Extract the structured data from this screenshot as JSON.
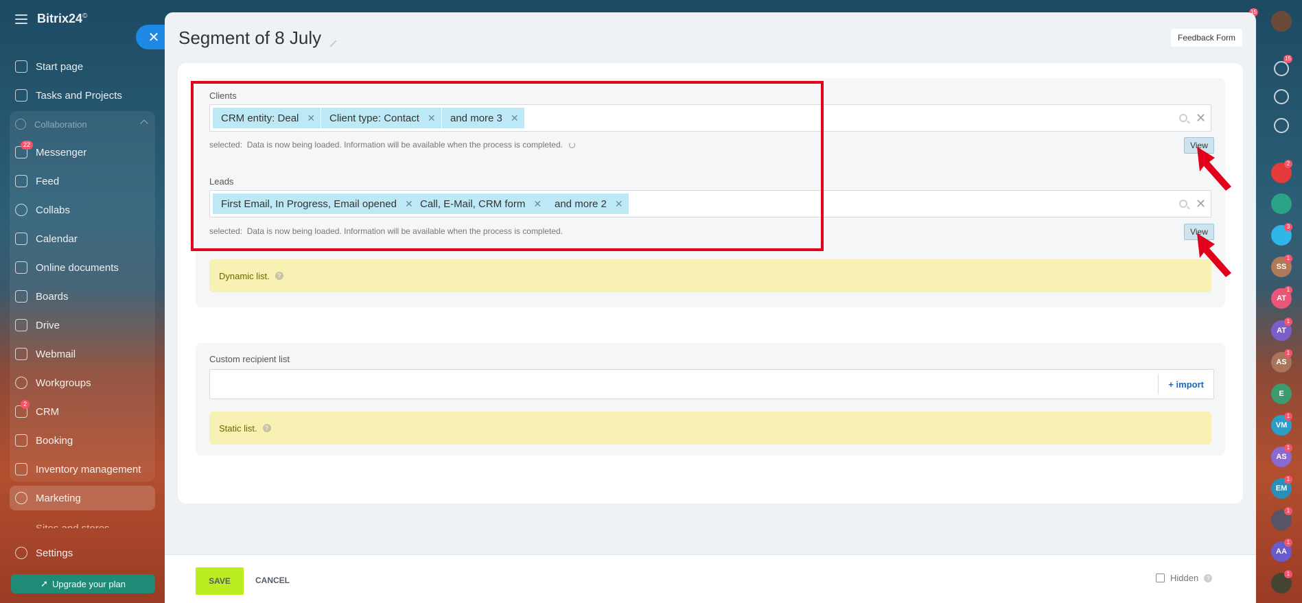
{
  "sidebar": {
    "logo": "Bitrix24",
    "logo_mark": "©",
    "items": [
      {
        "label": "Start page",
        "badge": ""
      },
      {
        "label": "Tasks and Projects",
        "badge": ""
      },
      {
        "label": "Messenger",
        "badge": "22"
      },
      {
        "label": "Feed",
        "badge": ""
      },
      {
        "label": "Collabs",
        "badge": ""
      },
      {
        "label": "Calendar",
        "badge": ""
      },
      {
        "label": "Online documents",
        "badge": ""
      },
      {
        "label": "Boards",
        "badge": ""
      },
      {
        "label": "Drive",
        "badge": ""
      },
      {
        "label": "Webmail",
        "badge": ""
      },
      {
        "label": "Workgroups",
        "badge": ""
      },
      {
        "label": "CRM",
        "badge": "2"
      },
      {
        "label": "Booking",
        "badge": ""
      },
      {
        "label": "Inventory management",
        "badge": ""
      },
      {
        "label": "Marketing",
        "badge": ""
      },
      {
        "label": "Sites and stores",
        "badge": ""
      },
      {
        "label": "Settings",
        "badge": ""
      }
    ],
    "collaboration_label": "Collaboration",
    "upgrade_label": "Upgrade your plan"
  },
  "right_rail": {
    "top_badge": "15",
    "notifications_badge": "15",
    "contacts": [
      {
        "initials": "",
        "badge": "2",
        "color": "#e43a3a"
      },
      {
        "initials": "",
        "badge": "",
        "color": "#2aa387"
      },
      {
        "initials": "",
        "badge": "3",
        "color": "#2fb5e8"
      },
      {
        "initials": "SS",
        "badge": "1",
        "color": "#b07a5a"
      },
      {
        "initials": "AT",
        "badge": "1",
        "color": "#e8567a"
      },
      {
        "initials": "AT",
        "badge": "1",
        "color": "#7a5fc8"
      },
      {
        "initials": "AS",
        "badge": "1",
        "color": "#a8745a"
      },
      {
        "initials": "E",
        "badge": "",
        "color": "#3d9a6e"
      },
      {
        "initials": "VM",
        "badge": "1",
        "color": "#2a9ec8"
      },
      {
        "initials": "AS",
        "badge": "1",
        "color": "#8a6ad0"
      },
      {
        "initials": "EM",
        "badge": "1",
        "color": "#2a8fb8"
      },
      {
        "initials": "",
        "badge": "1",
        "color": "#557"
      },
      {
        "initials": "AA",
        "badge": "1",
        "color": "#6a5ad0"
      },
      {
        "initials": "",
        "badge": "1",
        "color": "#443"
      }
    ]
  },
  "page": {
    "title": "Segment of 8 July",
    "feedback_button": "Feedback Form"
  },
  "clients": {
    "label": "Clients",
    "tags": [
      "CRM entity: Deal",
      "Client type: Contact",
      "and more 3"
    ],
    "status_prefix": "selected:",
    "status_text": "Data is now being loaded. Information will be available when the process is completed.",
    "view_label": "View"
  },
  "leads": {
    "label": "Leads",
    "tags": [
      "First Email, In Progress, Email opened",
      "Call, E-Mail, CRM form",
      "and more 2"
    ],
    "status_prefix": "selected:",
    "status_text": "Data is now being loaded. Information will be available when the process is completed.",
    "view_label": "View"
  },
  "dynamic_list_label": "Dynamic list.",
  "custom_recipients": {
    "label": "Custom recipient list",
    "import_label": "+ import",
    "static_list_label": "Static list."
  },
  "footer": {
    "save_label": "SAVE",
    "cancel_label": "CANCEL",
    "hidden_label": "Hidden"
  },
  "colors": {
    "highlight": "#e2001a",
    "tag_bg": "#bde8f6",
    "save_bg": "#bbed21",
    "notice_bg": "#f7f2b3"
  }
}
